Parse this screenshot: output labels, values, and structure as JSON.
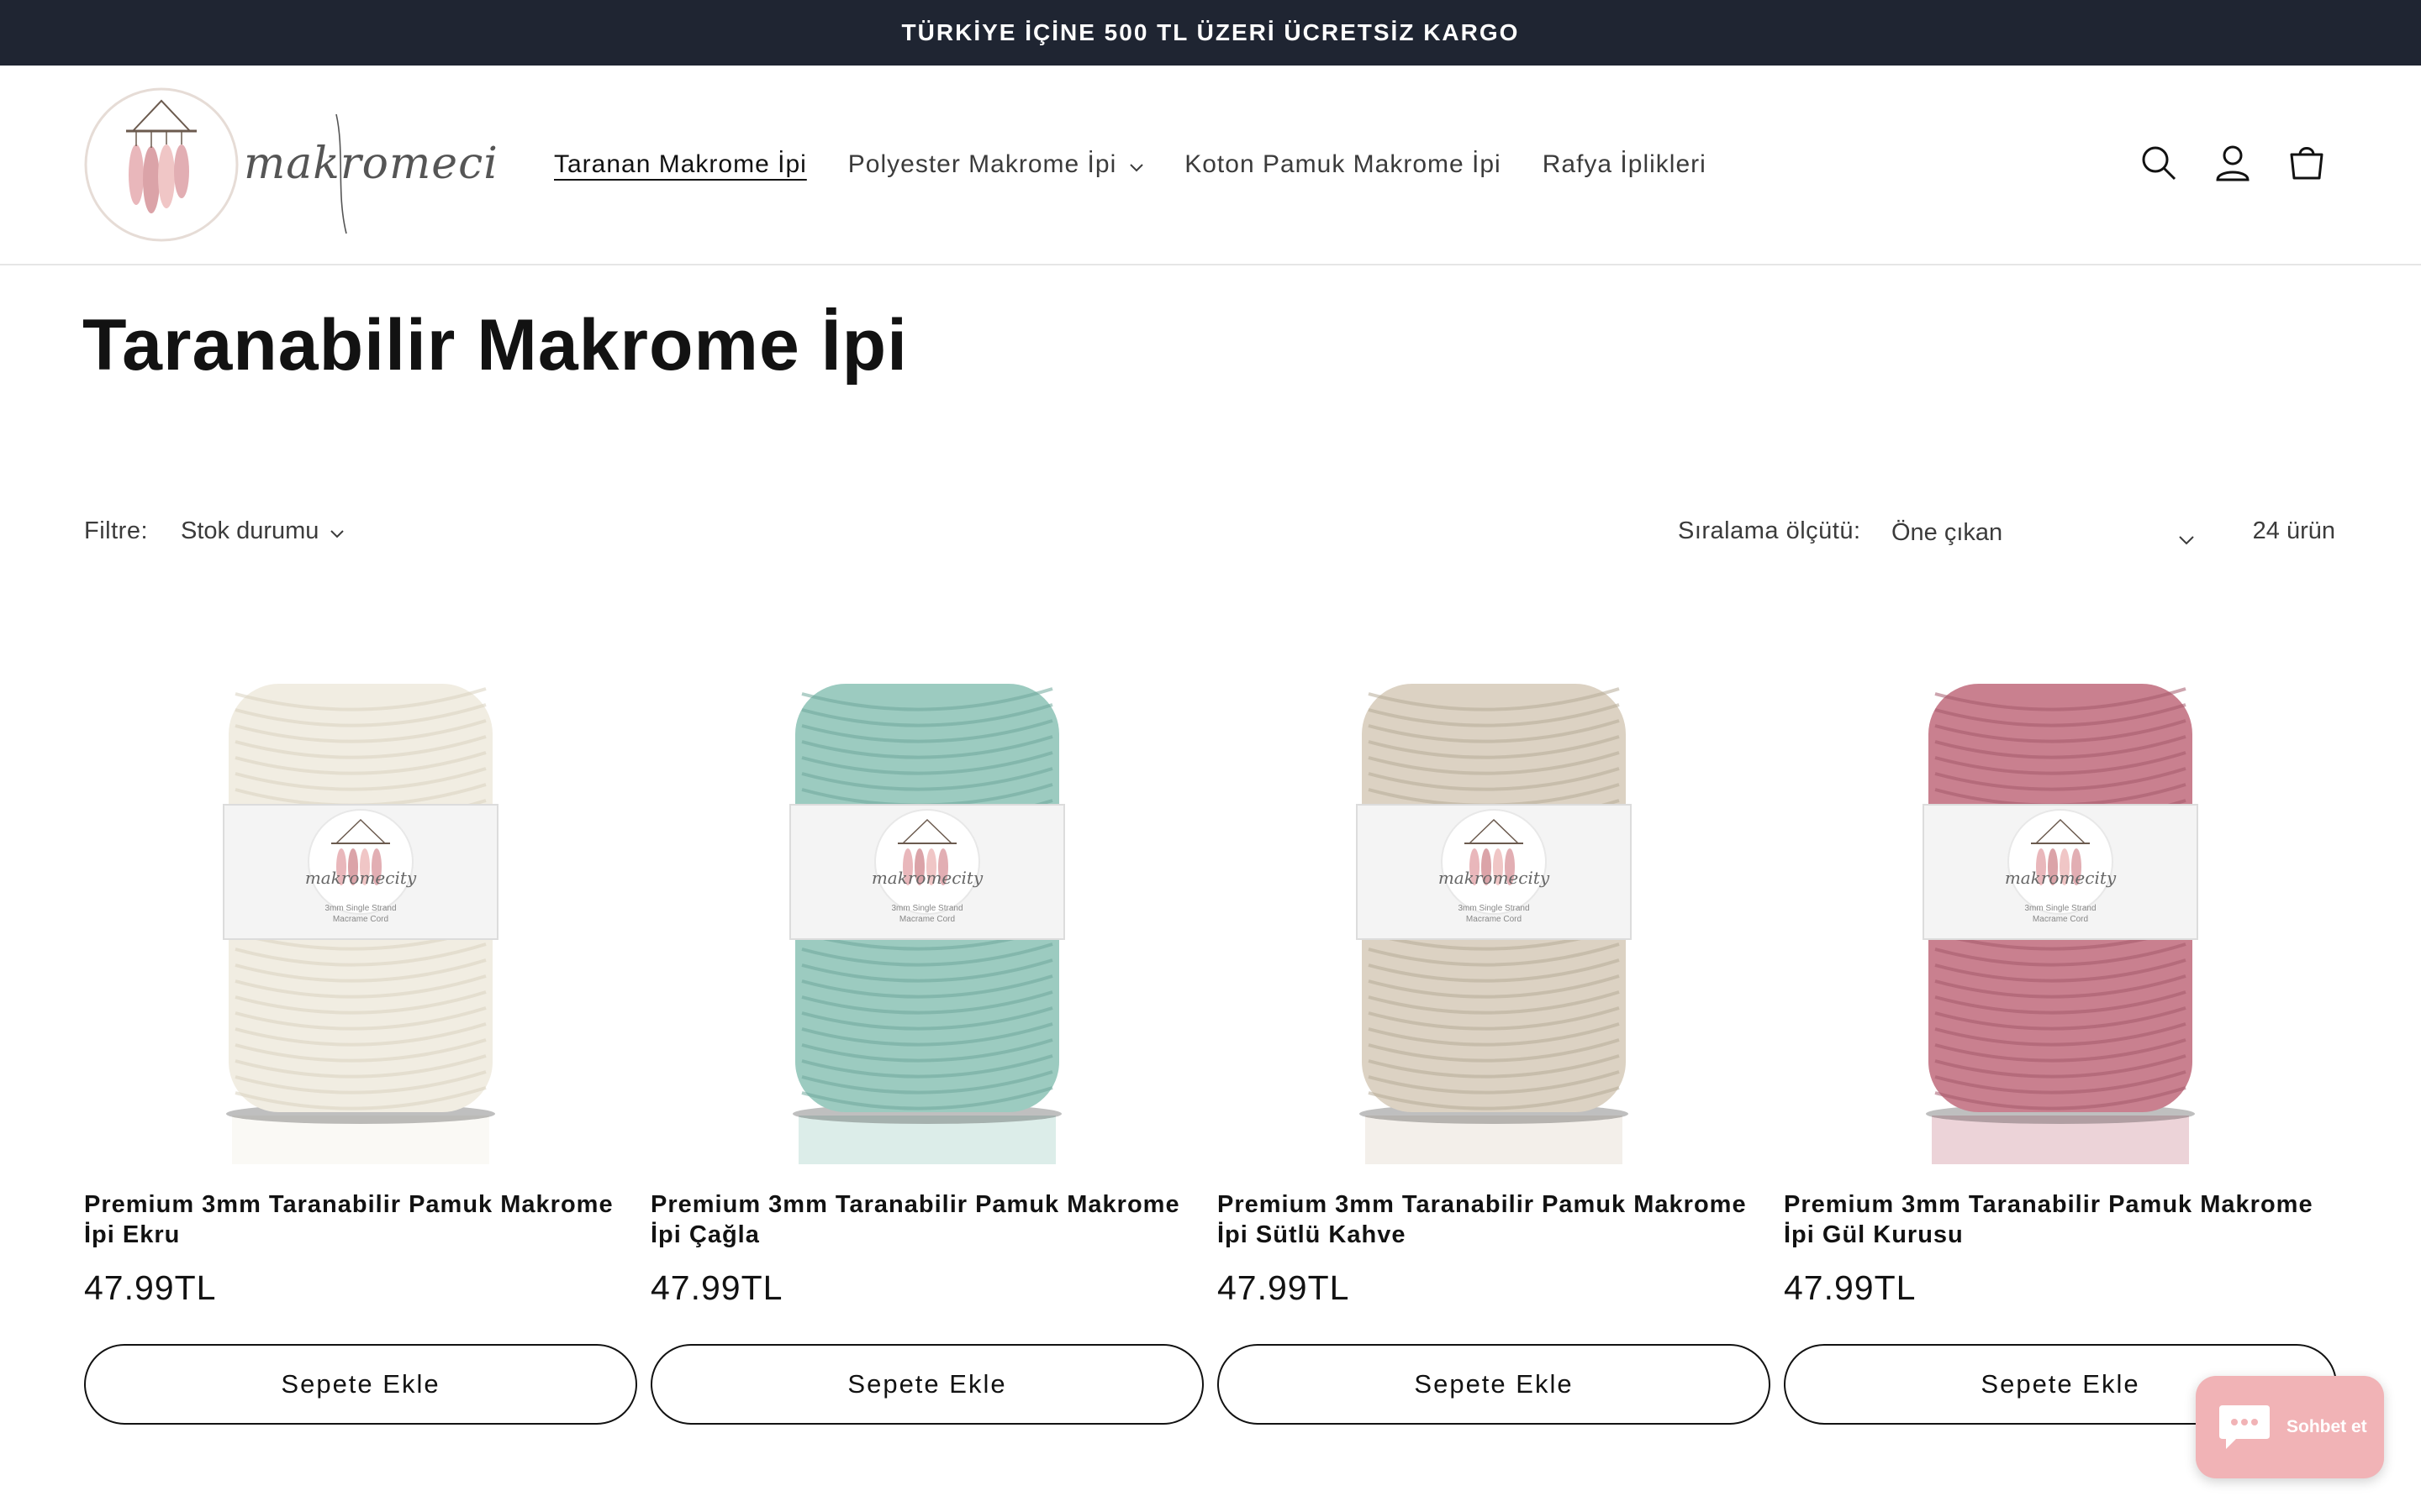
{
  "announcement": {
    "text": "TÜRKİYE İÇİNE 500 TL ÜZERİ ÜCRETSİZ KARGO"
  },
  "brand": {
    "logo_text": "makromecity",
    "logo_icon": "macrame-feathers-logo"
  },
  "nav": {
    "items": [
      {
        "label": "Taranan Makrome İpi",
        "active": true,
        "has_dropdown": false
      },
      {
        "label": "Polyester Makrome İpi",
        "active": false,
        "has_dropdown": true
      },
      {
        "label": "Koton Pamuk Makrome İpi",
        "active": false,
        "has_dropdown": false
      },
      {
        "label": "Rafya İplikleri",
        "active": false,
        "has_dropdown": false
      }
    ],
    "icons": [
      "search-icon",
      "account-icon",
      "cart-icon"
    ]
  },
  "collection": {
    "title": "Taranabilir Makrome İpi",
    "filter_label": "Filtre:",
    "filter_stock": "Stok durumu",
    "sort_label": "Sıralama ölçütü:",
    "sort_value": "Öne çıkan",
    "count": "24 ürün"
  },
  "products": [
    {
      "title": "Premium 3mm Taranabilir Pamuk Makrome İpi Ekru",
      "price": "47.99TL",
      "button": "Sepete Ekle",
      "color": "#f1ede2",
      "color_dark": "#d8d1bf"
    },
    {
      "title": "Premium 3mm Taranabilir Pamuk Makrome İpi Çağla",
      "price": "47.99TL",
      "button": "Sepete Ekle",
      "color": "#9ccbc0",
      "color_dark": "#6fa79a"
    },
    {
      "title": "Premium 3mm Taranabilir Pamuk Makrome İpi Sütlü Kahve",
      "price": "47.99TL",
      "button": "Sepete Ekle",
      "color": "#dcd2c3",
      "color_dark": "#b7ab98"
    },
    {
      "title": "Premium 3mm Taranabilir Pamuk Makrome İpi Gül Kurusu",
      "price": "47.99TL",
      "button": "Sepete Ekle",
      "color": "#c9808f",
      "color_dark": "#a45a6b"
    }
  ],
  "label_band": {
    "brand": "makromecity",
    "line1": "3mm Single Strand",
    "line2": "Macrame Cord"
  },
  "chat": {
    "label": "Sohbet et",
    "color": "#f1b3b6"
  },
  "colors": {
    "announcement_bg": "#1f2532",
    "text": "#121212"
  }
}
